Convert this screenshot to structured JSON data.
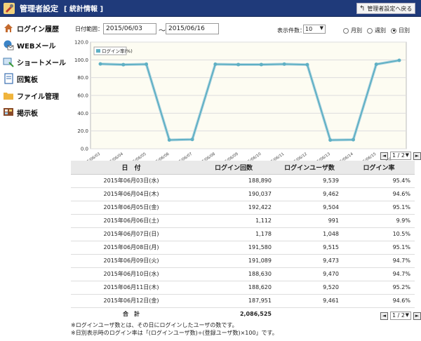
{
  "header": {
    "title": "管理者設定",
    "subtitle": "[ 統計情報 ]",
    "back_label": "管理者設定へ戻る"
  },
  "sidebar": {
    "items": [
      {
        "label": "ログイン履歴",
        "icon": "house-icon"
      },
      {
        "label": "WEBメール",
        "icon": "globe-mail-icon"
      },
      {
        "label": "ショートメール",
        "icon": "short-mail-icon"
      },
      {
        "label": "回覧板",
        "icon": "notebook-icon"
      },
      {
        "label": "ファイル管理",
        "icon": "folder-icon"
      },
      {
        "label": "掲示板",
        "icon": "board-icon"
      }
    ]
  },
  "filter": {
    "range_label": "日付範囲：",
    "date_from": "2015/06/03",
    "tilde": "～",
    "date_to": "2015/06/16",
    "count_label": "表示件数：",
    "count_value": "10",
    "radios": [
      {
        "label": "月別",
        "checked": false
      },
      {
        "label": "週別",
        "checked": false
      },
      {
        "label": "日別",
        "checked": true
      }
    ]
  },
  "chart_data": {
    "type": "line",
    "legend": "ログイン率(%)",
    "categories": [
      "15/06/03",
      "15/06/04",
      "15/06/05",
      "15/06/06",
      "15/06/07",
      "15/06/08",
      "15/06/09",
      "15/06/10",
      "15/06/11",
      "15/06/12",
      "15/06/13",
      "15/06/14",
      "15/06/15",
      "15/06/16"
    ],
    "series": [
      {
        "name": "ログイン率(%)",
        "values": [
          95.4,
          94.6,
          95.1,
          9.9,
          10.5,
          95.1,
          94.7,
          94.7,
          95.2,
          94.6,
          9.8,
          10.2,
          95.0,
          99.5
        ]
      }
    ],
    "ylim": [
      0,
      120
    ],
    "yticks": [
      "0.0",
      "20.0",
      "40.0",
      "60.0",
      "80.0",
      "100.0",
      "120.0"
    ],
    "colors": {
      "line": "#5fb0c4",
      "bg": "#fdfcf2"
    }
  },
  "pager": {
    "prev": "◄",
    "page": "1 / 2",
    "next": "►"
  },
  "table": {
    "headers": [
      "日　付",
      "ログイン回数",
      "ログインユーザ数",
      "ログイン率"
    ],
    "rows": [
      [
        "2015年06月03日(水)",
        "188,890",
        "9,539",
        "95.4%"
      ],
      [
        "2015年06月04日(木)",
        "190,037",
        "9,462",
        "94.6%"
      ],
      [
        "2015年06月05日(金)",
        "192,422",
        "9,504",
        "95.1%"
      ],
      [
        "2015年06月06日(土)",
        "1,112",
        "991",
        "9.9%"
      ],
      [
        "2015年06月07日(日)",
        "1,178",
        "1,048",
        "10.5%"
      ],
      [
        "2015年06月08日(月)",
        "191,580",
        "9,515",
        "95.1%"
      ],
      [
        "2015年06月09日(火)",
        "191,089",
        "9,473",
        "94.7%"
      ],
      [
        "2015年06月10日(水)",
        "188,630",
        "9,470",
        "94.7%"
      ],
      [
        "2015年06月11日(木)",
        "188,620",
        "9,520",
        "95.2%"
      ],
      [
        "2015年06月12日(金)",
        "187,951",
        "9,461",
        "94.6%"
      ]
    ],
    "total_label": "合　計",
    "total_value": "2,086,525"
  },
  "notes": [
    "※ログインユーザ数とは、その日にログインしたユーザの数です。",
    "※日別表示時のログイン率は「(ログインユーザ数)÷(登録ユーザ数)×100」です。"
  ]
}
